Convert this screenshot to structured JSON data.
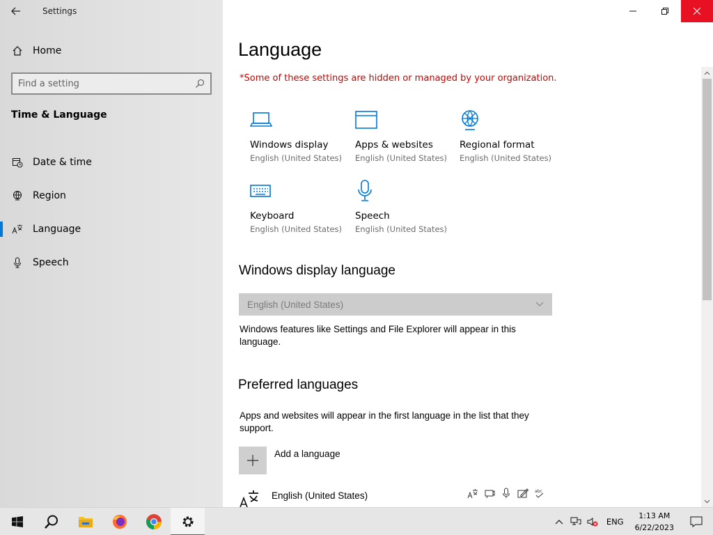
{
  "window": {
    "app_title": "Settings"
  },
  "sidebar": {
    "home_label": "Home",
    "search_placeholder": "Find a setting",
    "section_title": "Time & Language",
    "items": [
      {
        "label": "Date & time",
        "icon": "date-time-icon"
      },
      {
        "label": "Region",
        "icon": "globe-icon"
      },
      {
        "label": "Language",
        "icon": "language-icon",
        "active": true
      },
      {
        "label": "Speech",
        "icon": "microphone-icon"
      }
    ]
  },
  "main": {
    "title": "Language",
    "managed_note": "*Some of these settings are hidden or managed by your organization.",
    "tiles": [
      {
        "name": "Windows display",
        "sub": "English (United States)",
        "icon": "laptop-icon"
      },
      {
        "name": "Apps & websites",
        "sub": "English (United States)",
        "icon": "window-icon"
      },
      {
        "name": "Regional format",
        "sub": "English (United States)",
        "icon": "regional-format-icon"
      },
      {
        "name": "Keyboard",
        "sub": "English (United States)",
        "icon": "keyboard-icon"
      },
      {
        "name": "Speech",
        "sub": "English (United States)",
        "icon": "microphone-icon"
      }
    ],
    "display_language": {
      "heading": "Windows display language",
      "selected": "English (United States)",
      "description": "Windows features like Settings and File Explorer will appear in this language."
    },
    "preferred": {
      "heading": "Preferred languages",
      "description": "Apps and websites will appear in the first language in the list that they support.",
      "add_label": "Add a language",
      "languages": [
        {
          "name": "English (United States)"
        }
      ]
    }
  },
  "taskbar": {
    "apps": [
      "start-icon",
      "search-icon",
      "file-explorer-icon",
      "firefox-icon",
      "chrome-icon",
      "settings-icon"
    ],
    "tray_lang": "ENG",
    "time": "1:13 AM",
    "date": "6/22/2023"
  },
  "colors": {
    "accent": "#0078d7",
    "warning": "#c50500",
    "close_hover": "#e81123"
  }
}
